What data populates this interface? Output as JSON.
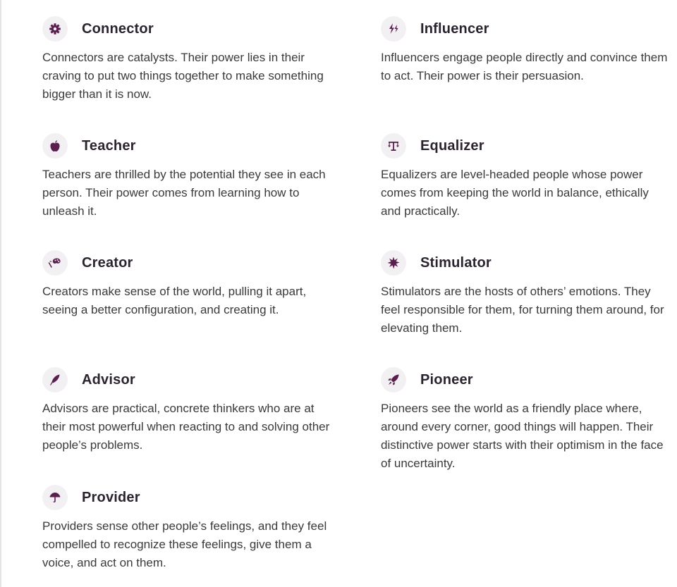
{
  "accent_color": "#5b1f4f",
  "cards": [
    {
      "title": "Connector",
      "icon": "gear-icon",
      "description": "Connectors are catalysts. Their power lies in their craving to put two things together to make something bigger than it is now."
    },
    {
      "title": "Influencer",
      "icon": "lightning-icon",
      "description": "Influencers engage people directly and convince them to act. Their power is their persuasion."
    },
    {
      "title": "Teacher",
      "icon": "apple-icon",
      "description": "Teachers are thrilled by the potential they see in each person. Their power comes from learning how to unleash it."
    },
    {
      "title": "Equalizer",
      "icon": "scale-icon",
      "description": "Equalizers are level-headed people whose power comes from keeping the world in balance, ethically and practically."
    },
    {
      "title": "Creator",
      "icon": "palette-icon",
      "description": "Creators make sense of the world, pulling it apart, seeing a better configuration, and creating it."
    },
    {
      "title": "Stimulator",
      "icon": "burst-icon",
      "description": "Stimulators are the hosts of others’ emotions. They feel responsible for them, for turning them around, for elevating them."
    },
    {
      "title": "Advisor",
      "icon": "quill-icon",
      "description": "Advisors are practical, concrete thinkers who are at their most powerful when reacting to and solving other people’s problems."
    },
    {
      "title": "Pioneer",
      "icon": "rocket-icon",
      "description": "Pioneers see the world as a friendly place where, around every corner, good things will happen. Their distinctive power starts with their optimism in the face of uncertainty."
    },
    {
      "title": "Provider",
      "icon": "umbrella-icon",
      "description": "Providers sense other people’s feelings, and they feel compelled to recognize these feelings, give them a voice, and act on them."
    }
  ]
}
